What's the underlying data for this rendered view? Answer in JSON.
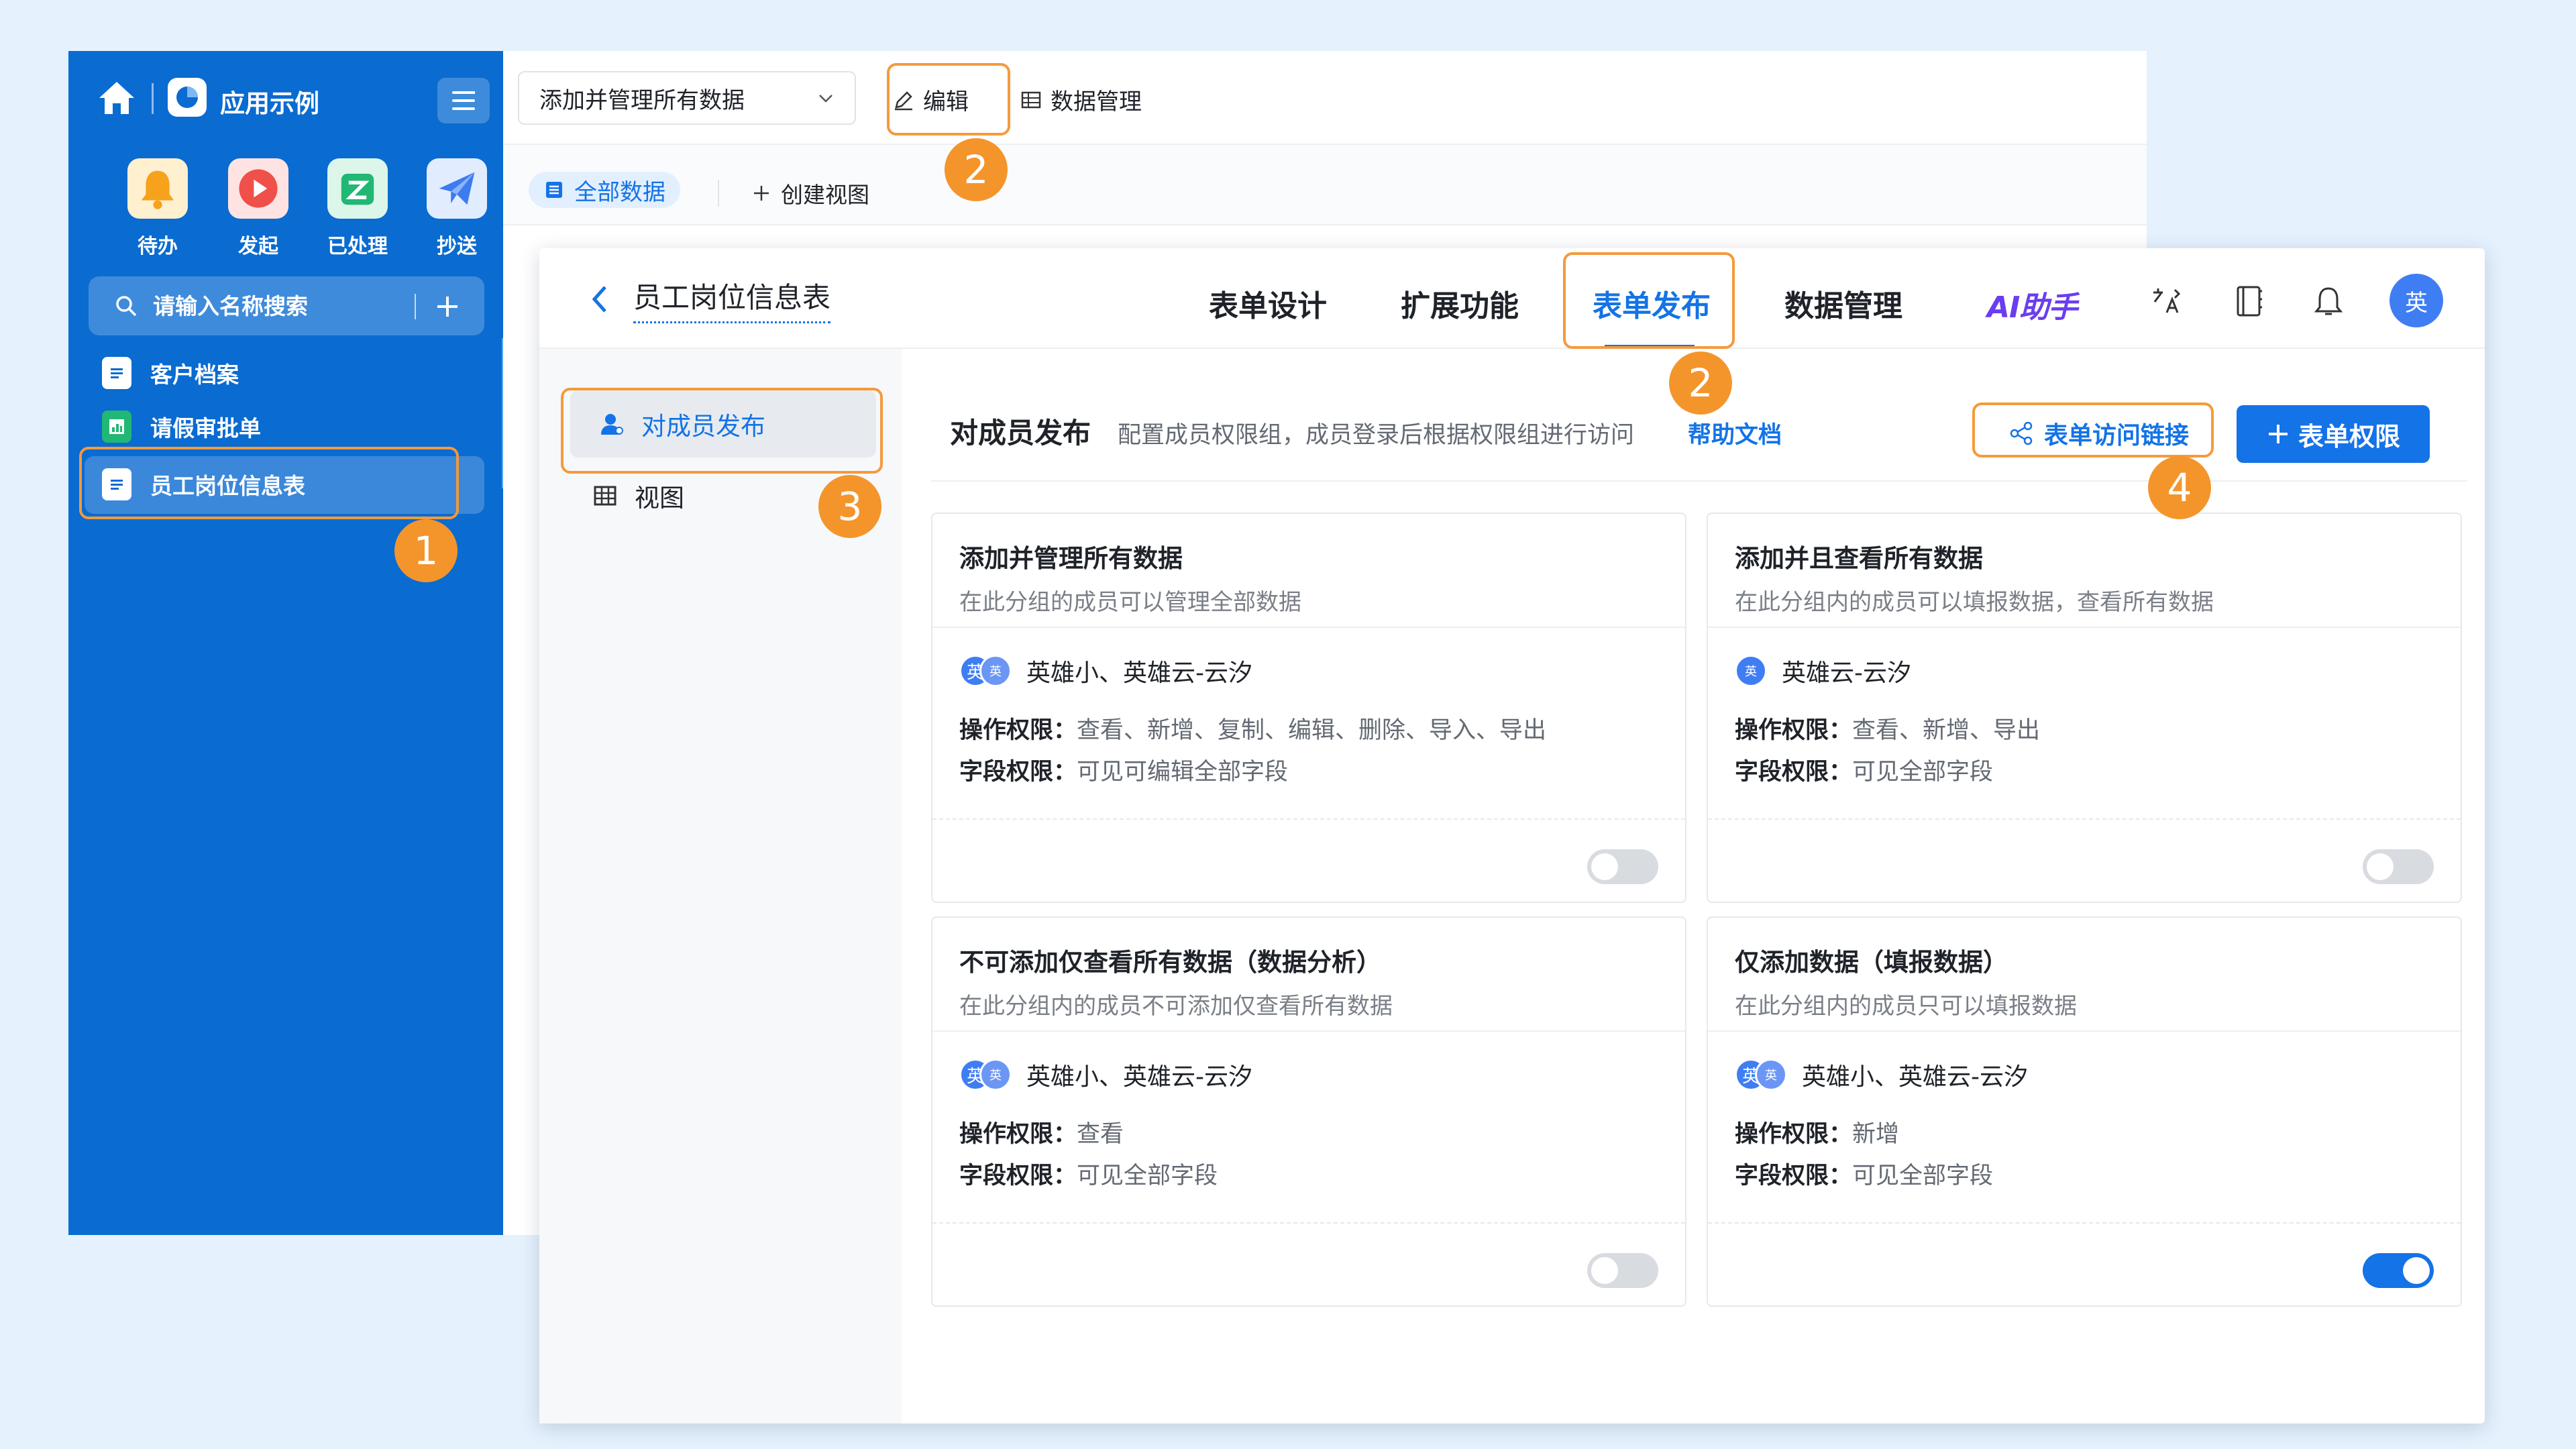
{
  "sidebar": {
    "app_title": "应用示例",
    "quick_actions": [
      {
        "label": "待办",
        "icon": "bell-icon",
        "color": "#f7a21c"
      },
      {
        "label": "发起",
        "icon": "play-icon",
        "color": "#f0504a"
      },
      {
        "label": "已处理",
        "icon": "check-box-icon",
        "color": "#21b774"
      },
      {
        "label": "抄送",
        "icon": "paper-plane-icon",
        "color": "#3c7cf0"
      }
    ],
    "search_placeholder": "请输入名称搜索",
    "items": [
      {
        "label": "客户档案",
        "icon": "document-icon"
      },
      {
        "label": "请假审批单",
        "icon": "chart-doc-icon"
      },
      {
        "label": "员工岗位信息表",
        "icon": "document-icon"
      }
    ]
  },
  "background_window": {
    "view_selector": "添加并管理所有数据",
    "edit_label": "编辑",
    "data_manage_label": "数据管理",
    "tabs": {
      "all_data": "全部数据",
      "create_view": "创建视图"
    }
  },
  "main": {
    "form_title": "员工岗位信息表",
    "tabs": [
      "表单设计",
      "扩展功能",
      "表单发布",
      "数据管理"
    ],
    "active_tab": "表单发布",
    "ai_assistant": "AI助手",
    "avatar_text": "英",
    "left_nav": {
      "member_publish": "对成员发布",
      "view": "视图"
    },
    "section": {
      "title": "对成员发布",
      "description": "配置成员权限组，成员登录后根据权限组进行访问",
      "help_link": "帮助文档",
      "access_link_button": "表单访问链接",
      "permission_button": "表单权限"
    },
    "labels": {
      "ops": "操作权限：",
      "fields": "字段权限："
    },
    "cards": [
      {
        "title": "添加并管理所有数据",
        "desc": "在此分组的成员可以管理全部数据",
        "members": "英雄小、英雄云-云汐",
        "ops": "查看、新增、复制、编辑、删除、导入、导出",
        "fields": "可见可编辑全部字段",
        "enabled": false
      },
      {
        "title": "添加并且查看所有数据",
        "desc": "在此分组内的成员可以填报数据，查看所有数据",
        "members": "英雄云-云汐",
        "ops": "查看、新增、导出",
        "fields": "可见全部字段",
        "enabled": false
      },
      {
        "title": "不可添加仅查看所有数据（数据分析）",
        "desc": "在此分组内的成员不可添加仅查看所有数据",
        "members": "英雄小、英雄云-云汐",
        "ops": "查看",
        "fields": "可见全部字段",
        "enabled": false
      },
      {
        "title": "仅添加数据（填报数据）",
        "desc": "在此分组内的成员只可以填报数据",
        "members": "英雄小、英雄云-云汐",
        "ops": "新增",
        "fields": "可见全部字段",
        "enabled": true
      }
    ]
  },
  "annotations": [
    "1",
    "2",
    "2",
    "3",
    "4"
  ],
  "colors": {
    "sidebar": "#0a6bd1",
    "primary": "#1473e6",
    "annotation": "#f4952c",
    "background": "#e5f1fd"
  }
}
